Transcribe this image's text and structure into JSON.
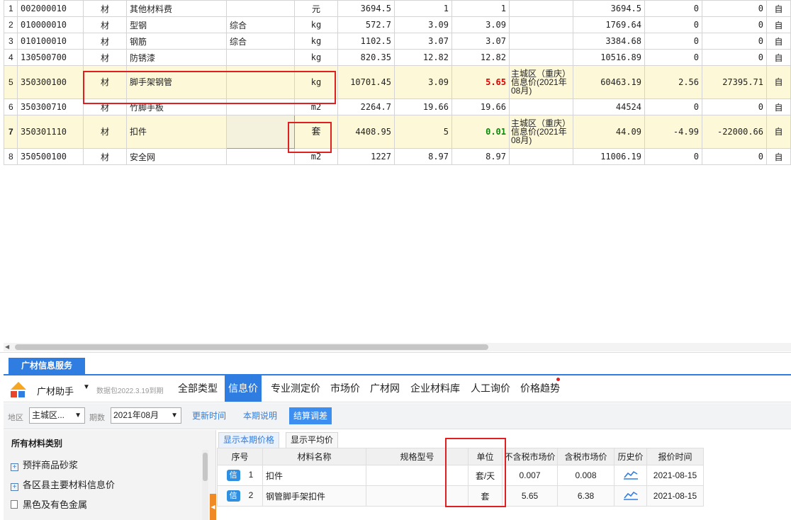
{
  "grid": {
    "rows": [
      {
        "n": "1",
        "code": "002000010",
        "type": "材",
        "name": "其他材料费",
        "spec": "",
        "unit": "元",
        "qty": "3694.5",
        "p1": "1",
        "p2": "1",
        "src": "",
        "amt": "3694.5",
        "diff": "0",
        "diffsum": "0",
        "last": "自",
        "tall": false,
        "hl": false,
        "p2class": ""
      },
      {
        "n": "2",
        "code": "010000010",
        "type": "材",
        "name": "型钢",
        "spec": "综合",
        "unit": "kg",
        "qty": "572.7",
        "p1": "3.09",
        "p2": "3.09",
        "src": "",
        "amt": "1769.64",
        "diff": "0",
        "diffsum": "0",
        "last": "自",
        "tall": false,
        "hl": false,
        "p2class": ""
      },
      {
        "n": "3",
        "code": "010100010",
        "type": "材",
        "name": "钢筋",
        "spec": "综合",
        "unit": "kg",
        "qty": "1102.5",
        "p1": "3.07",
        "p2": "3.07",
        "src": "",
        "amt": "3384.68",
        "diff": "0",
        "diffsum": "0",
        "last": "自",
        "tall": false,
        "hl": false,
        "p2class": ""
      },
      {
        "n": "4",
        "code": "130500700",
        "type": "材",
        "name": "防锈漆",
        "spec": "",
        "unit": "kg",
        "qty": "820.35",
        "p1": "12.82",
        "p2": "12.82",
        "src": "",
        "amt": "10516.89",
        "diff": "0",
        "diffsum": "0",
        "last": "自",
        "tall": false,
        "hl": false,
        "p2class": ""
      },
      {
        "n": "5",
        "code": "350300100",
        "type": "材",
        "name": "脚手架钢管",
        "spec": "",
        "unit": "kg",
        "qty": "10701.45",
        "p1": "3.09",
        "p2": "5.65",
        "src": "主城区（重庆）信息价(2021年08月)",
        "amt": "60463.19",
        "diff": "2.56",
        "diffsum": "27395.71",
        "last": "自",
        "tall": true,
        "hl": true,
        "p2class": "red"
      },
      {
        "n": "6",
        "code": "350300710",
        "type": "材",
        "name": "竹脚手板",
        "spec": "",
        "unit": "m2",
        "qty": "2264.7",
        "p1": "19.66",
        "p2": "19.66",
        "src": "",
        "amt": "44524",
        "diff": "0",
        "diffsum": "0",
        "last": "自",
        "tall": false,
        "hl": false,
        "p2class": ""
      },
      {
        "n": "7",
        "code": "350301110",
        "type": "材",
        "name": "扣件",
        "spec": "",
        "unit": "套",
        "qty": "4408.95",
        "p1": "5",
        "p2": "0.01",
        "src": "主城区（重庆）信息价(2021年08月)",
        "amt": "44.09",
        "diff": "-4.99",
        "diffsum": "-22000.66",
        "last": "自",
        "tall": true,
        "hl": true,
        "p2class": "green"
      },
      {
        "n": "8",
        "code": "350500100",
        "type": "材",
        "name": "安全网",
        "spec": "",
        "unit": "m2",
        "qty": "1227",
        "p1": "8.97",
        "p2": "8.97",
        "src": "",
        "amt": "11006.19",
        "diff": "0",
        "diffsum": "0",
        "last": "自",
        "tall": false,
        "hl": false,
        "p2class": ""
      }
    ]
  },
  "panel": {
    "service_tab": "广材信息服务",
    "assistant": {
      "name": "广材助手",
      "caret": "▼",
      "package_note": "数据包2022.3.19到期"
    },
    "main_tabs": [
      "全部类型",
      "信息价",
      "专业测定价",
      "市场价",
      "广材网",
      "企业材料库",
      "人工询价",
      "价格趋势"
    ],
    "active_tab": "信息价",
    "filter": {
      "region_label": "地区",
      "region_value": "主城区...",
      "period_label": "期数",
      "period_value": "2021年08月",
      "update_time": "更新时间",
      "period_note": "本期说明",
      "settle": "结算调差"
    },
    "categories": {
      "header": "所有材料类别",
      "items": [
        {
          "label": "预拌商品砂浆",
          "icon": "expand-icon"
        },
        {
          "label": "各区县主要材料信息价",
          "icon": "expand-icon"
        },
        {
          "label": "黑色及有色金属",
          "icon": "document-icon"
        }
      ]
    },
    "sub_tabs": [
      "显示本期价格",
      "显示平均价"
    ],
    "result_headers": [
      "序号",
      "材料名称",
      "规格型号",
      "单位",
      "不含税市场价",
      "含税市场价",
      "历史价",
      "报价时间"
    ],
    "results": [
      {
        "badge": "信",
        "seq": "1",
        "name": "扣件",
        "spec": "",
        "unit": "套/天",
        "price_ex": "0.007",
        "price_in": "0.008",
        "date": "2021-08-15"
      },
      {
        "badge": "信",
        "seq": "2",
        "name": "钢管脚手架扣件",
        "spec": "",
        "unit": "套",
        "price_ex": "5.65",
        "price_in": "6.38",
        "date": "2021-08-15"
      }
    ]
  },
  "colors": {
    "accent": "#2f7de1",
    "highlight_row": "#fdf8d8",
    "annotation_red": "#e02020",
    "price_up": "#dd0000",
    "price_down": "#0a8a0a"
  }
}
